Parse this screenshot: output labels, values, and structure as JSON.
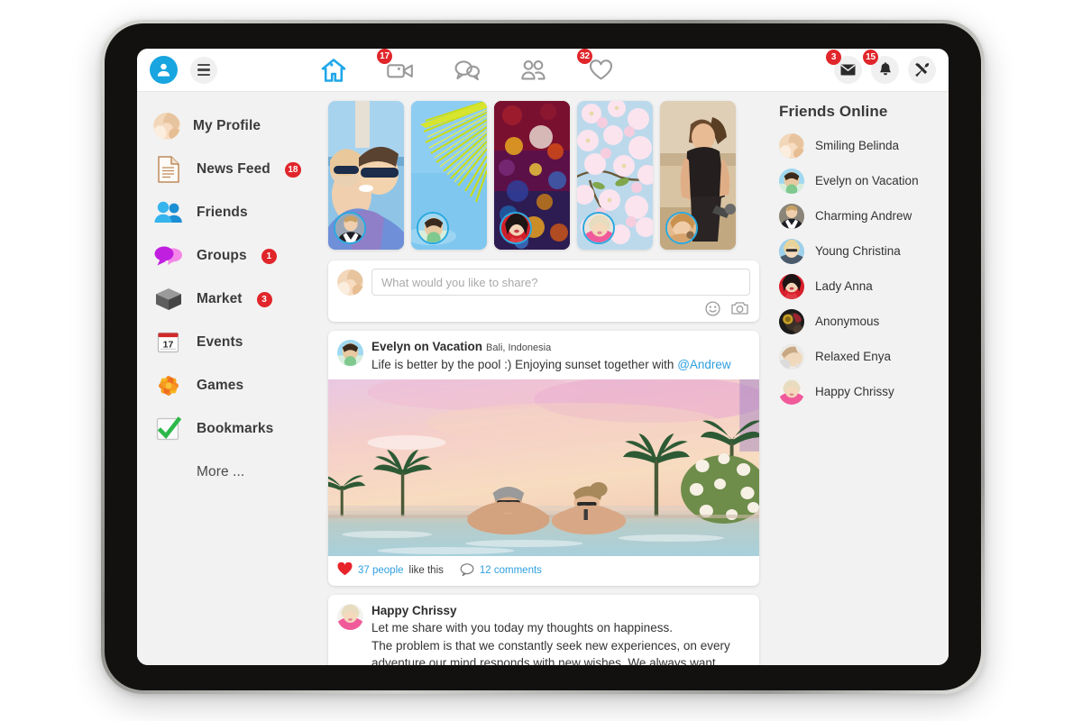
{
  "topbar": {
    "profile_icon": "person-avatar-icon",
    "menu_icon": "hamburger-menu-icon",
    "nav": [
      {
        "name": "home-icon",
        "label": "Home",
        "badge": null,
        "active": true
      },
      {
        "name": "video-icon",
        "label": "Video",
        "badge": "17",
        "active": false
      },
      {
        "name": "messages-icon",
        "label": "Messages",
        "badge": null,
        "active": false
      },
      {
        "name": "people-icon",
        "label": "People",
        "badge": null,
        "active": false
      },
      {
        "name": "heart-icon",
        "label": "Likes",
        "badge": "32",
        "active": false
      }
    ],
    "actions": [
      {
        "name": "mail-icon",
        "label": "Messages",
        "badge": "3"
      },
      {
        "name": "bell-icon",
        "label": "Notifications",
        "badge": "15"
      },
      {
        "name": "tools-icon",
        "label": "Settings",
        "badge": null
      }
    ]
  },
  "sidebar": {
    "items": [
      {
        "label": "My Profile",
        "icon": "profile-photo-avatar",
        "badge": null
      },
      {
        "label": "News Feed",
        "icon": "document-icon",
        "badge": "18"
      },
      {
        "label": "Friends",
        "icon": "friends-icon",
        "badge": null
      },
      {
        "label": "Groups",
        "icon": "speech-bubbles-icon",
        "badge": "1"
      },
      {
        "label": "Market",
        "icon": "box-icon",
        "badge": "3"
      },
      {
        "label": "Events",
        "icon": "calendar-icon",
        "badge": null
      },
      {
        "label": "Games",
        "icon": "pinwheel-icon",
        "badge": null
      },
      {
        "label": "Bookmarks",
        "icon": "checkmark-box-icon",
        "badge": null
      },
      {
        "label": "More ...",
        "icon": null,
        "badge": null
      }
    ],
    "calendar_day": "17",
    "calendar_month": "MONTH",
    "calendar_weekday": "MONDAY"
  },
  "stories": [
    {
      "name": "story-couple-beach"
    },
    {
      "name": "story-palm-leaf"
    },
    {
      "name": "story-bokeh-lights"
    },
    {
      "name": "story-cherry-blossom"
    },
    {
      "name": "story-fitness-sunset"
    }
  ],
  "composer": {
    "placeholder": "What would you like to share?",
    "value": "",
    "emoji_icon": "smiley-face-icon",
    "camera_icon": "camera-icon"
  },
  "posts": [
    {
      "author": "Evelyn on Vacation",
      "location": "Bali, Indonesia",
      "text_before": "Life is better by the pool :) Enjoying sunset together with ",
      "mention": "@Andrew",
      "image": "infinity-pool-sunset-photo",
      "likes_count": "37 people",
      "likes_suffix": "like this",
      "comments": "12 comments",
      "like_icon": "heart-filled-icon",
      "comment_icon": "speech-bubble-icon"
    },
    {
      "author": "Happy Chrissy",
      "location": "",
      "line1": "Let me share with you today my thoughts on happiness.",
      "line2": "The problem is that we constantly seek new experiences, on every adventure our mind responds with new wishes. We always want something more and better. But happiness lies in not needing more"
    }
  ],
  "friends_panel": {
    "title": "Friends Online",
    "friends": [
      {
        "name": "Smiling Belinda"
      },
      {
        "name": "Evelyn on Vacation"
      },
      {
        "name": "Charming Andrew"
      },
      {
        "name": "Young Christina"
      },
      {
        "name": "Lady Anna"
      },
      {
        "name": "Anonymous"
      },
      {
        "name": "Relaxed Enya"
      },
      {
        "name": "Happy Chrissy"
      }
    ]
  },
  "colors": {
    "accent_blue": "#2aa9e0",
    "badge_red": "#e0262b",
    "link_blue": "#2f9fe0",
    "page_bg": "#f2f2f2"
  }
}
